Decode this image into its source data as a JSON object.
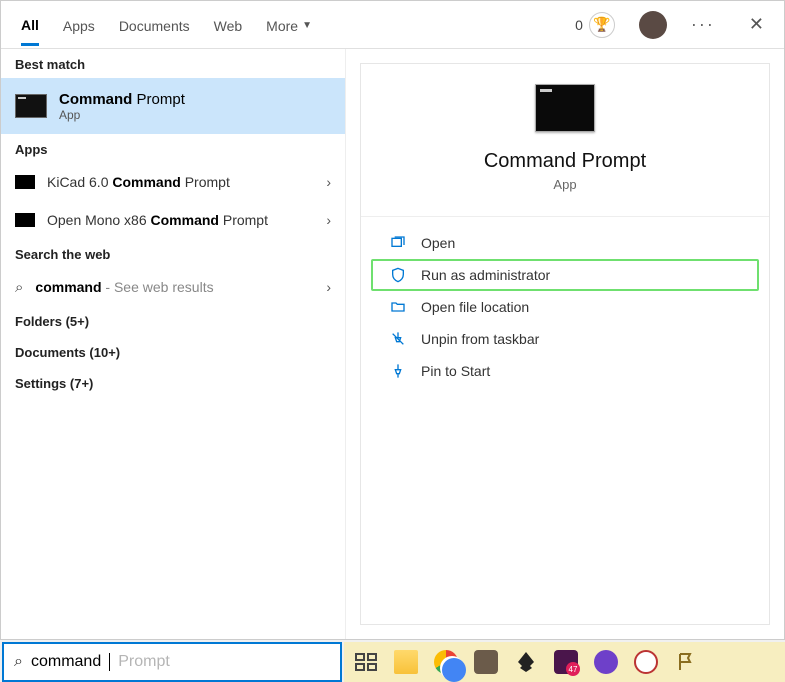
{
  "tabs": {
    "all": "All",
    "apps": "Apps",
    "documents": "Documents",
    "web": "Web",
    "more": "More"
  },
  "header": {
    "points": "0"
  },
  "left": {
    "best_match_label": "Best match",
    "best_match": {
      "name_bold": "Command",
      "name_rest": " Prompt",
      "sub": "App"
    },
    "apps_label": "Apps",
    "app1": {
      "pre": "KiCad 6.0 ",
      "bold": "Command",
      "post": " Prompt"
    },
    "app2": {
      "pre": "Open Mono x86 ",
      "bold": "Command",
      "post": " Prompt"
    },
    "web_label": "Search the web",
    "web": {
      "bold": "command",
      "hint": " - See web results"
    },
    "folders": "Folders (5+)",
    "documents": "Documents (10+)",
    "settings": "Settings (7+)"
  },
  "detail": {
    "title": "Command Prompt",
    "sub": "App",
    "open": "Open",
    "run_admin": "Run as administrator",
    "open_loc": "Open file location",
    "unpin": "Unpin from taskbar",
    "pin_start": "Pin to Start"
  },
  "search": {
    "typed": "command",
    "ghost": "Prompt"
  }
}
